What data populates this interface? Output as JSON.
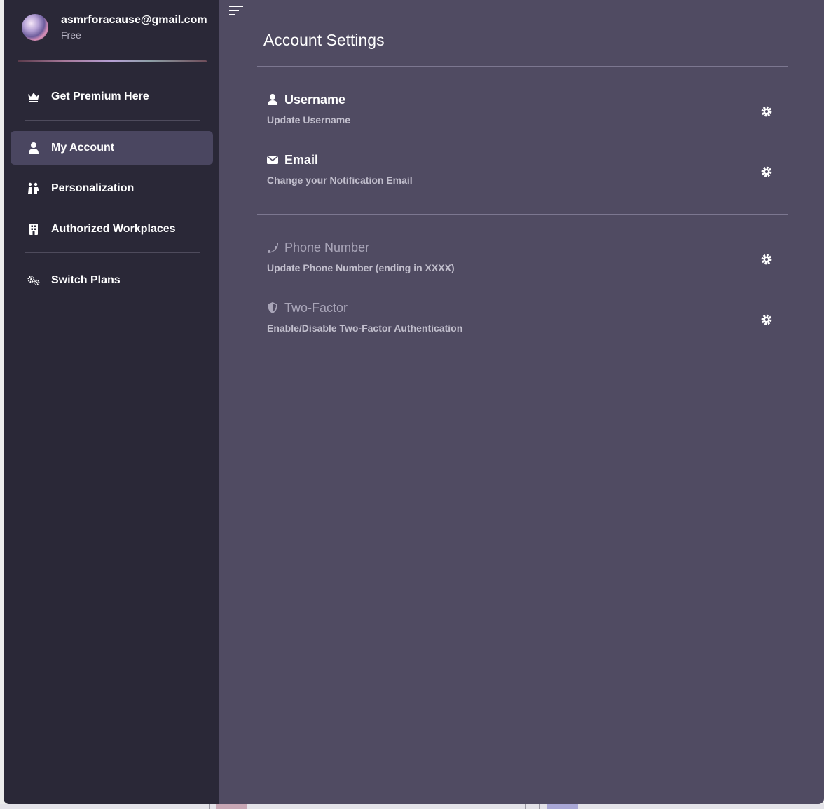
{
  "user": {
    "email": "asmrforacause@gmail.com",
    "plan": "Free"
  },
  "sidebar": {
    "items": [
      {
        "label": "Get Premium Here",
        "icon": "crown-icon"
      },
      {
        "label": "My Account",
        "icon": "user-icon",
        "active": true
      },
      {
        "label": "Personalization",
        "icon": "personalization-icon"
      },
      {
        "label": "Authorized Workplaces",
        "icon": "building-icon"
      },
      {
        "label": "Switch Plans",
        "icon": "gears-icon"
      }
    ]
  },
  "main": {
    "title": "Account Settings",
    "settings": [
      {
        "title": "Username",
        "description": "Update Username",
        "icon": "user-icon",
        "enabled": true
      },
      {
        "title": "Email",
        "description": "Change your Notification Email",
        "icon": "envelope-icon",
        "enabled": true
      },
      {
        "title": "Phone Number",
        "description": "Update Phone Number (ending in XXXX)",
        "icon": "phone-icon",
        "enabled": false
      },
      {
        "title": "Two-Factor",
        "description": "Enable/Disable Two-Factor Authentication",
        "icon": "shield-icon",
        "enabled": false
      }
    ]
  },
  "colors": {
    "sidebar_bg": "#2a2837",
    "main_bg": "#504b62",
    "active_item_bg": "#4a4660",
    "text_primary": "#ffffff",
    "text_muted": "#c2bfcd"
  }
}
